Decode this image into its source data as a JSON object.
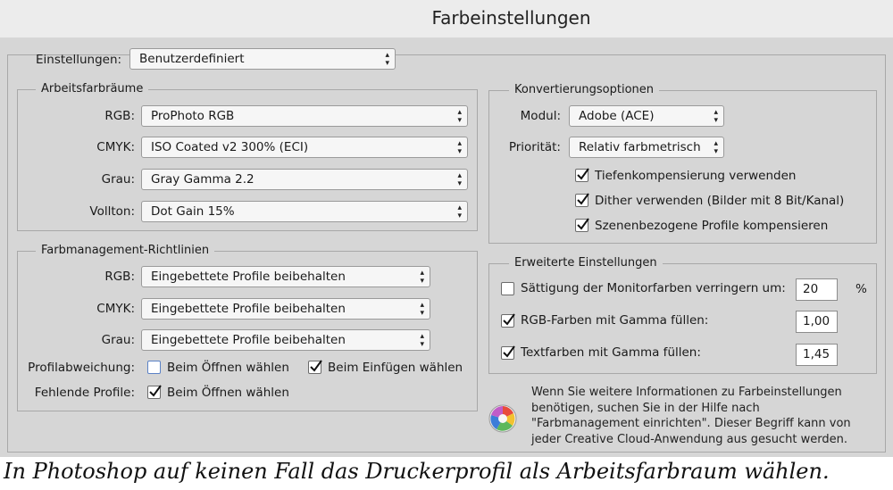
{
  "window": {
    "title": "Farbeinstellungen"
  },
  "einstellungen": {
    "label": "Einstellungen:",
    "value": "Benutzerdefiniert"
  },
  "arbeitsfarbraeume": {
    "legend": "Arbeitsfarbräume",
    "rows": [
      {
        "label": "RGB:",
        "value": "ProPhoto RGB"
      },
      {
        "label": "CMYK:",
        "value": "ISO Coated v2 300% (ECI)"
      },
      {
        "label": "Grau:",
        "value": "Gray Gamma 2.2"
      },
      {
        "label": "Vollton:",
        "value": "Dot Gain 15%"
      }
    ]
  },
  "richtlinien": {
    "legend": "Farbmanagement-Richtlinien",
    "rows": [
      {
        "label": "RGB:",
        "value": "Eingebettete Profile beibehalten"
      },
      {
        "label": "CMYK:",
        "value": "Eingebettete Profile beibehalten"
      },
      {
        "label": "Grau:",
        "value": "Eingebettete Profile beibehalten"
      }
    ],
    "profilabweichung": {
      "label": "Profilabweichung:",
      "open": {
        "text": "Beim Öffnen wählen",
        "checked": false
      },
      "paste": {
        "text": "Beim Einfügen wählen",
        "checked": true
      }
    },
    "fehlende": {
      "label": "Fehlende Profile:",
      "open": {
        "text": "Beim Öffnen wählen",
        "checked": true
      }
    }
  },
  "konvertierung": {
    "legend": "Konvertierungsoptionen",
    "modul": {
      "label": "Modul:",
      "value": "Adobe (ACE)"
    },
    "prioritaet": {
      "label": "Priorität:",
      "value": "Relativ farbmetrisch"
    },
    "checks": [
      {
        "text": "Tiefenkompensierung verwenden",
        "checked": true
      },
      {
        "text": "Dither verwenden (Bilder mit 8 Bit/Kanal)",
        "checked": true
      },
      {
        "text": "Szenenbezogene Profile kompensieren",
        "checked": true
      }
    ]
  },
  "erweitert": {
    "legend": "Erweiterte Einstellungen",
    "saettigung": {
      "text": "Sättigung der Monitorfarben verringern um:",
      "checked": false,
      "value": "20",
      "unit": "%"
    },
    "rgb_gamma": {
      "text": "RGB-Farben mit Gamma füllen:",
      "checked": true,
      "value": "1,00"
    },
    "text_gamma": {
      "text": "Textfarben mit Gamma füllen:",
      "checked": true,
      "value": "1,45"
    }
  },
  "info": {
    "icon": "color-wheel-icon",
    "text": "Wenn Sie weitere Informationen zu Farbeinstellungen benötigen, suchen Sie in der Hilfe nach \"Farbmanagement einrichten\". Dieser Begriff kann von jeder Creative Cloud-Anwendung aus gesucht werden."
  },
  "caption": "In Photoshop auf keinen Fall das Druckerprofil als Arbeitsfarbraum wählen."
}
